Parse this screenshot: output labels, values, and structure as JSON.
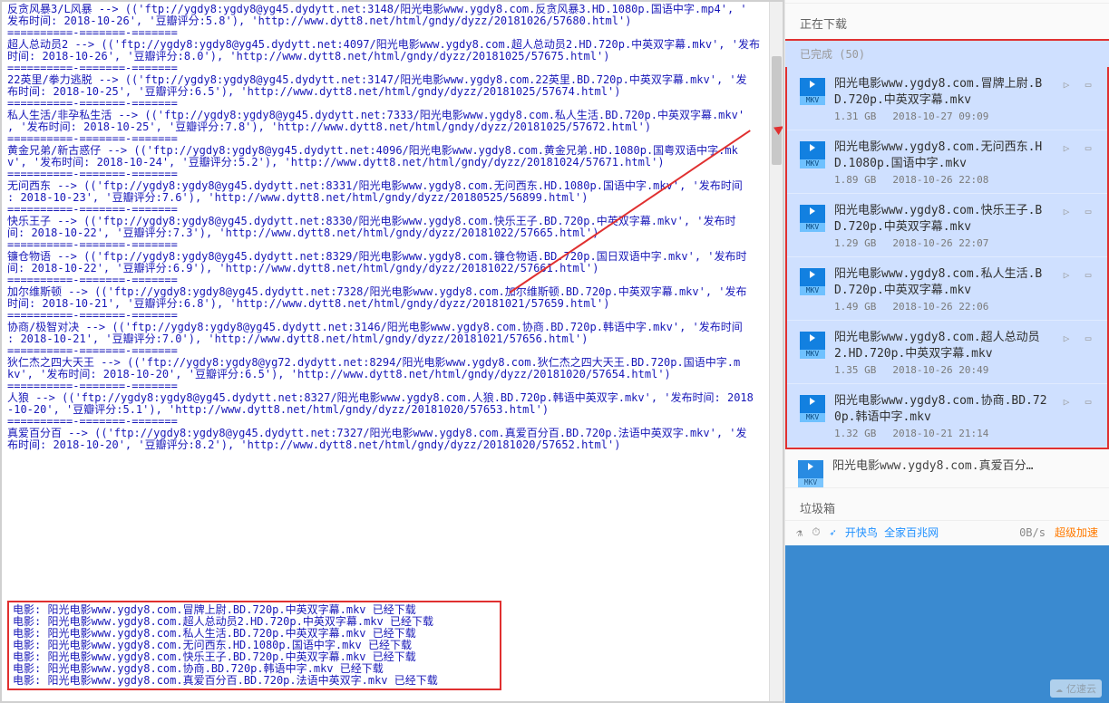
{
  "console_lines": [
    "反贪风暴3/L风暴 --> (('ftp://ygdy8:ygdy8@yg45.dydytt.net:3148/阳光电影www.ygdy8.com.反贪风暴3.HD.1080p.国语中字.mp4', '",
    "发布时间: 2018-10-26', '豆瓣评分:5.8'), 'http://www.dytt8.net/html/gndy/dyzz/20181026/57680.html')",
    "==========-=======-=======",
    "超人总动员2 --> (('ftp://ygdy8:ygdy8@yg45.dydytt.net:4097/阳光电影www.ygdy8.com.超人总动员2.HD.720p.中英双字幕.mkv', '发布",
    "时间: 2018-10-26', '豆瓣评分:8.0'), 'http://www.dytt8.net/html/gndy/dyzz/20181025/57675.html')",
    "==========-=======-=======",
    "22英里/拳力逃脱 --> (('ftp://ygdy8:ygdy8@yg45.dydytt.net:3147/阳光电影www.ygdy8.com.22英里.BD.720p.中英双字幕.mkv', '发",
    "布时间: 2018-10-25', '豆瓣评分:6.5'), 'http://www.dytt8.net/html/gndy/dyzz/20181025/57674.html')",
    "==========-=======-=======",
    "私人生活/非孕私生活 --> (('ftp://ygdy8:ygdy8@yg45.dydytt.net:7333/阳光电影www.ygdy8.com.私人生活.BD.720p.中英双字幕.mkv'",
    ", '发布时间: 2018-10-25', '豆瓣评分:7.8'), 'http://www.dytt8.net/html/gndy/dyzz/20181025/57672.html')",
    "==========-=======-=======",
    "黄金兄弟/新古惑仔 --> (('ftp://ygdy8:ygdy8@yg45.dydytt.net:4096/阳光电影www.ygdy8.com.黄金兄弟.HD.1080p.国粤双语中字.mk",
    "v', '发布时间: 2018-10-24', '豆瓣评分:5.2'), 'http://www.dytt8.net/html/gndy/dyzz/20181024/57671.html')",
    "==========-=======-=======",
    "无问西东 --> (('ftp://ygdy8:ygdy8@yg45.dydytt.net:8331/阳光电影www.ygdy8.com.无问西东.HD.1080p.国语中字.mkv', '发布时间",
    ": 2018-10-23', '豆瓣评分:7.6'), 'http://www.dytt8.net/html/gndy/dyzz/20180525/56899.html')",
    "==========-=======-=======",
    "快乐王子 --> (('ftp://ygdy8:ygdy8@yg45.dydytt.net:8330/阳光电影www.ygdy8.com.快乐王子.BD.720p.中英双字幕.mkv', '发布时",
    "间: 2018-10-22', '豆瓣评分:7.3'), 'http://www.dytt8.net/html/gndy/dyzz/20181022/57665.html')",
    "==========-=======-=======",
    "镰仓物语 --> (('ftp://ygdy8:ygdy8@yg45.dydytt.net:8329/阳光电影www.ygdy8.com.镰仓物语.BD.720p.国日双语中字.mkv', '发布时",
    "间: 2018-10-22', '豆瓣评分:6.9'), 'http://www.dytt8.net/html/gndy/dyzz/20181022/57661.html')",
    "==========-=======-=======",
    "加尔维斯顿 --> (('ftp://ygdy8:ygdy8@yg45.dydytt.net:7328/阳光电影www.ygdy8.com.加尔维斯顿.BD.720p.中英双字幕.mkv', '发布",
    "时间: 2018-10-21', '豆瓣评分:6.8'), 'http://www.dytt8.net/html/gndy/dyzz/20181021/57659.html')",
    "==========-=======-=======",
    "协商/极智对决 --> (('ftp://ygdy8:ygdy8@yg45.dydytt.net:3146/阳光电影www.ygdy8.com.协商.BD.720p.韩语中字.mkv', '发布时间",
    ": 2018-10-21', '豆瓣评分:7.0'), 'http://www.dytt8.net/html/gndy/dyzz/20181021/57656.html')",
    "==========-=======-=======",
    "狄仁杰之四大天王 --> (('ftp://ygdy8:ygdy8@yg72.dydytt.net:8294/阳光电影www.ygdy8.com.狄仁杰之四大天王.BD.720p.国语中字.m",
    "kv', '发布时间: 2018-10-20', '豆瓣评分:6.5'), 'http://www.dytt8.net/html/gndy/dyzz/20181020/57654.html')",
    "==========-=======-=======",
    "人狼 --> (('ftp://ygdy8:ygdy8@yg45.dydytt.net:8327/阳光电影www.ygdy8.com.人狼.BD.720p.韩语中英双字.mkv', '发布时间: 2018",
    "-10-20', '豆瓣评分:5.1'), 'http://www.dytt8.net/html/gndy/dyzz/20181020/57653.html')",
    "==========-=======-=======",
    "真爱百分百 --> (('ftp://ygdy8:ygdy8@yg45.dydytt.net:7327/阳光电影www.ygdy8.com.真爱百分百.BD.720p.法语中英双字.mkv', '发",
    "布时间: 2018-10-20', '豆瓣评分:8.2'), 'http://www.dytt8.net/html/gndy/dyzz/20181020/57652.html')"
  ],
  "downloaded_lines": [
    "电影: 阳光电影www.ygdy8.com.冒牌上尉.BD.720p.中英双字幕.mkv 已经下载",
    "电影: 阳光电影www.ygdy8.com.超人总动员2.HD.720p.中英双字幕.mkv 已经下载",
    "电影: 阳光电影www.ygdy8.com.私人生活.BD.720p.中英双字幕.mkv 已经下载",
    "电影: 阳光电影www.ygdy8.com.无问西东.HD.1080p.国语中字.mkv 已经下载",
    "电影: 阳光电影www.ygdy8.com.快乐王子.BD.720p.中英双字幕.mkv 已经下载",
    "电影: 阳光电影www.ygdy8.com.协商.BD.720p.韩语中字.mkv 已经下载",
    "电影: 阳光电影www.ygdy8.com.真爱百分百.BD.720p.法语中英双字.mkv 已经下载"
  ],
  "right_panel": {
    "downloading_tab": "正在下载",
    "completed_label": "已完成 (50)",
    "items": [
      {
        "ext": "MKV",
        "name": "阳光电影www.ygdy8.com.冒牌上尉.BD.720p.中英双字幕.mkv",
        "size": "1.31 GB",
        "time": "2018-10-27 09:09"
      },
      {
        "ext": "MKV",
        "name": "阳光电影www.ygdy8.com.无问西东.HD.1080p.国语中字.mkv",
        "size": "1.89 GB",
        "time": "2018-10-26 22:08"
      },
      {
        "ext": "MKV",
        "name": "阳光电影www.ygdy8.com.快乐王子.BD.720p.中英双字幕.mkv",
        "size": "1.29 GB",
        "time": "2018-10-26 22:07"
      },
      {
        "ext": "MKV",
        "name": "阳光电影www.ygdy8.com.私人生活.BD.720p.中英双字幕.mkv",
        "size": "1.49 GB",
        "time": "2018-10-26 22:06"
      },
      {
        "ext": "MKV",
        "name": "阳光电影www.ygdy8.com.超人总动员2.HD.720p.中英双字幕.mkv",
        "size": "1.35 GB",
        "time": "2018-10-26 20:49"
      },
      {
        "ext": "MKV",
        "name": "阳光电影www.ygdy8.com.协商.BD.720p.韩语中字.mkv",
        "size": "1.32 GB",
        "time": "2018-10-21 21:14"
      }
    ],
    "peek_name": "阳光电影www.ygdy8.com.真爱百分…",
    "trash": "垃圾箱",
    "bird_text": "开快鸟  全家百兆网",
    "speed": "0B/s",
    "boost": "超级加速"
  },
  "watermark": "亿速云"
}
